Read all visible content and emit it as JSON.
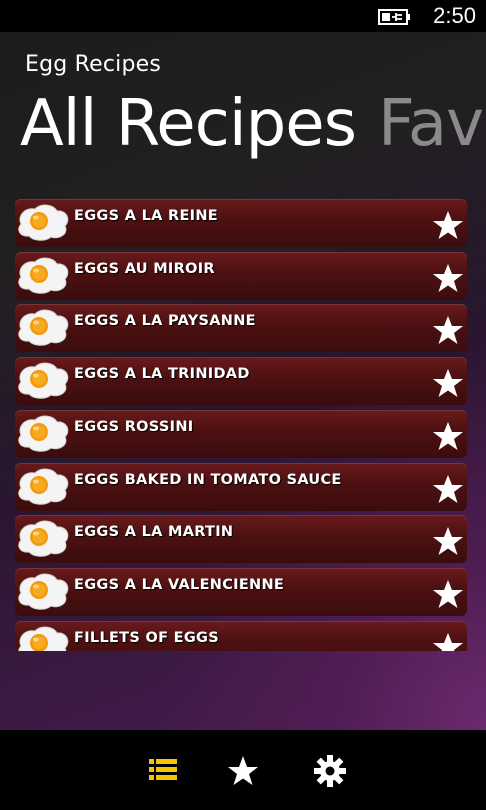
{
  "status_bar": {
    "time": "2:50",
    "battery_icon": "battery-charging-icon"
  },
  "app": {
    "title": "Egg Recipes",
    "pivot": {
      "active": "All Recipes",
      "inactive": "Favorites"
    }
  },
  "recipes": [
    {
      "name": "EGGS A LA REINE",
      "icon": "fried-egg-icon",
      "action_icon": "star-icon"
    },
    {
      "name": "EGGS AU MIROIR",
      "icon": "fried-egg-icon",
      "action_icon": "star-icon"
    },
    {
      "name": "EGGS A LA PAYSANNE",
      "icon": "fried-egg-icon",
      "action_icon": "star-icon"
    },
    {
      "name": "EGGS A LA TRINIDAD",
      "icon": "fried-egg-icon",
      "action_icon": "star-icon"
    },
    {
      "name": "EGGS ROSSINI",
      "icon": "fried-egg-icon",
      "action_icon": "star-icon"
    },
    {
      "name": "EGGS BAKED IN TOMATO SAUCE",
      "icon": "fried-egg-icon",
      "action_icon": "star-icon"
    },
    {
      "name": "EGGS A LA MARTIN",
      "icon": "fried-egg-icon",
      "action_icon": "star-icon"
    },
    {
      "name": "EGGS A LA VALENCIENNE",
      "icon": "fried-egg-icon",
      "action_icon": "star-icon"
    },
    {
      "name": "FILLETS OF EGGS",
      "icon": "fried-egg-icon",
      "action_icon": "star-icon"
    }
  ],
  "app_bar": {
    "buttons": [
      {
        "icon": "list-icon",
        "active": true
      },
      {
        "icon": "star-icon",
        "active": false
      },
      {
        "icon": "gear-icon",
        "active": false
      }
    ],
    "accent_color": "#f5c400"
  },
  "colors": {
    "row_background": "#5a1415",
    "background_accent": "#5e2566"
  }
}
